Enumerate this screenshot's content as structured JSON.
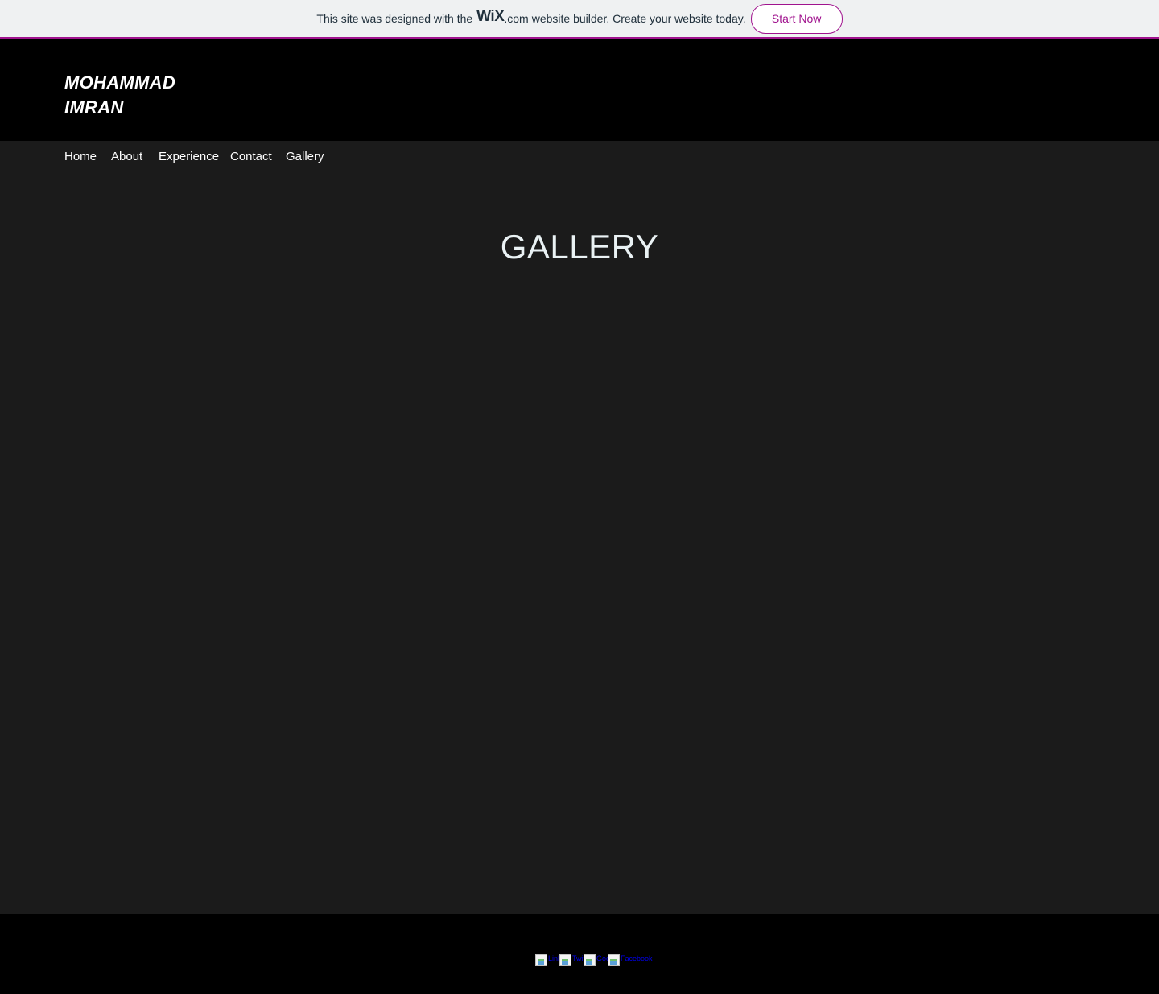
{
  "wix_banner": {
    "text_before": "This site was designed with the",
    "logo": "WiX",
    "dotcom": ".com",
    "text_after": "website builder. Create your website today.",
    "cta_label": "Start Now",
    "accent_color": "#a0138e"
  },
  "header": {
    "title_line1": "MOHAMMAD",
    "title_line2": "IMRAN"
  },
  "nav": {
    "items": [
      {
        "label": "Home"
      },
      {
        "label": "About"
      },
      {
        "label": "Experience"
      },
      {
        "label": "Contact"
      },
      {
        "label": "Gallery"
      }
    ]
  },
  "main": {
    "heading": "GALLERY"
  },
  "footer": {
    "social": [
      {
        "alt": "LinkedIn",
        "icon": "broken-image-icon"
      },
      {
        "alt": "Twitter",
        "icon": "broken-image-icon"
      },
      {
        "alt": "Google+",
        "icon": "broken-image-icon"
      },
      {
        "alt": "Facebook",
        "icon": "broken-image-icon"
      }
    ]
  }
}
